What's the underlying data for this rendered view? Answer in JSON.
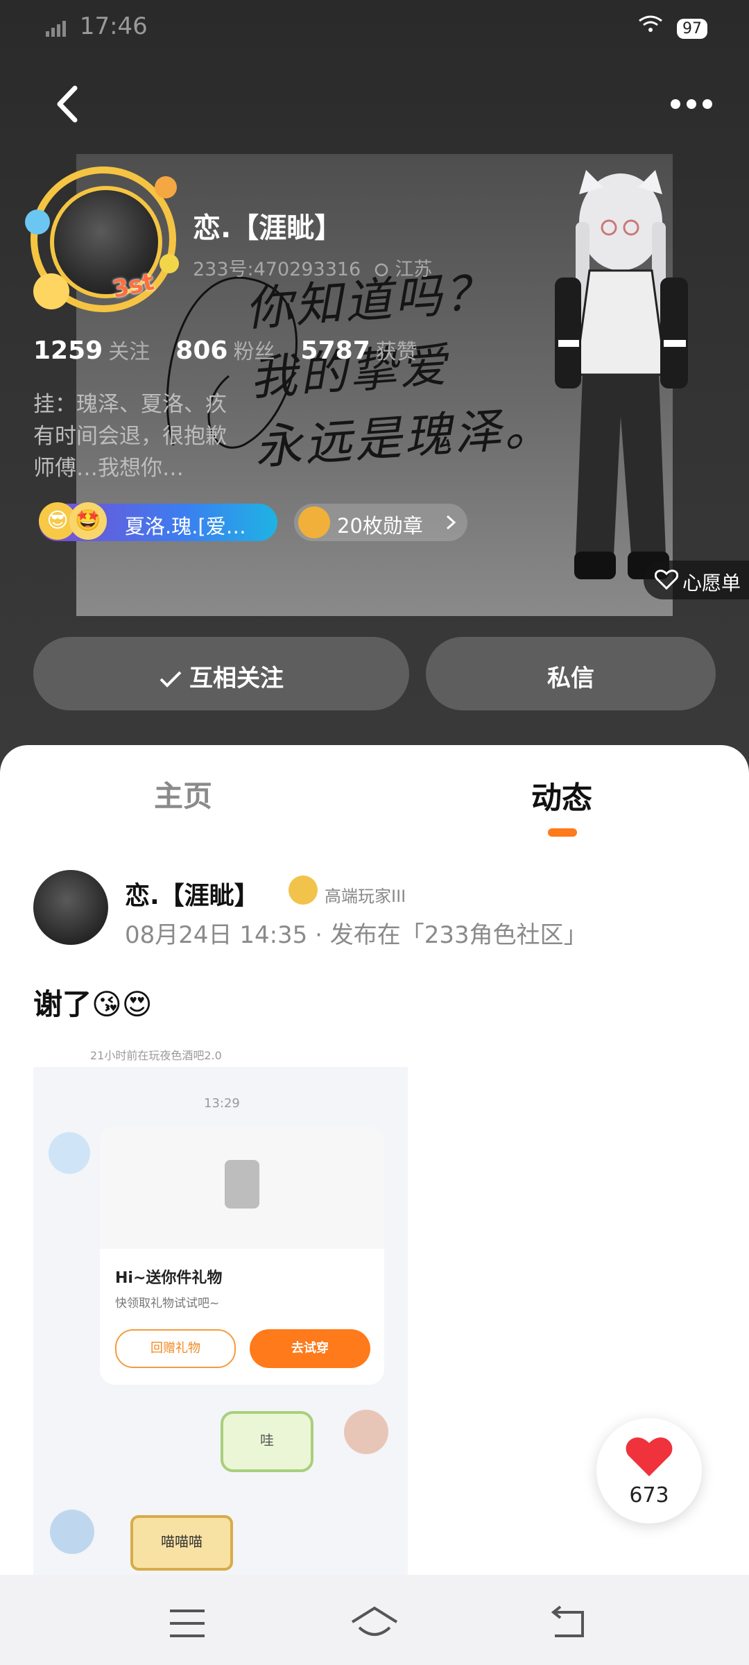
{
  "status_bar": {
    "time": "17:46",
    "battery": "97"
  },
  "profile": {
    "name": "恋.【涯眦】",
    "id_line": "233号:470293316",
    "location": "江苏",
    "frame_badge": "3st",
    "stats": [
      {
        "value": "1259",
        "label": "关注"
      },
      {
        "value": "806",
        "label": "粉丝"
      },
      {
        "value": "5787",
        "label": "获赞"
      }
    ],
    "bio_lines": [
      "挂：瑰泽、夏洛、疚",
      "有时间会退，很抱歉",
      "师傅…我想你…"
    ],
    "honor_pill": "夏洛.瑰.[爱…",
    "medals": "20枚勋章",
    "cover_text": [
      "你知道吗？",
      "我的挚爱",
      "永远是瑰泽。"
    ],
    "wishlist": "心愿单",
    "follow_button": "互相关注",
    "message_button": "私信"
  },
  "tabs": [
    {
      "label": "主页",
      "active": false
    },
    {
      "label": "动态",
      "active": true
    }
  ],
  "post": {
    "author": "恋.【涯眦】",
    "level": "高端玩家III",
    "meta": "08月24日 14:35 · 发布在「233角色社区」",
    "text": "谢了😘😍",
    "image": {
      "time_ago": "21小时前在玩夜色酒吧2.0",
      "clock": "13:29",
      "card_title": "Hi~送你件礼物",
      "card_sub": "快领取礼物试试吧~",
      "return_btn": "回赠礼物",
      "try_btn": "去试穿",
      "bubble_wa": "哇",
      "bubble_meow": "喵喵喵"
    }
  },
  "like_count": "673",
  "colors": {
    "accent": "#ff7a1a",
    "like": "#f0323c"
  }
}
